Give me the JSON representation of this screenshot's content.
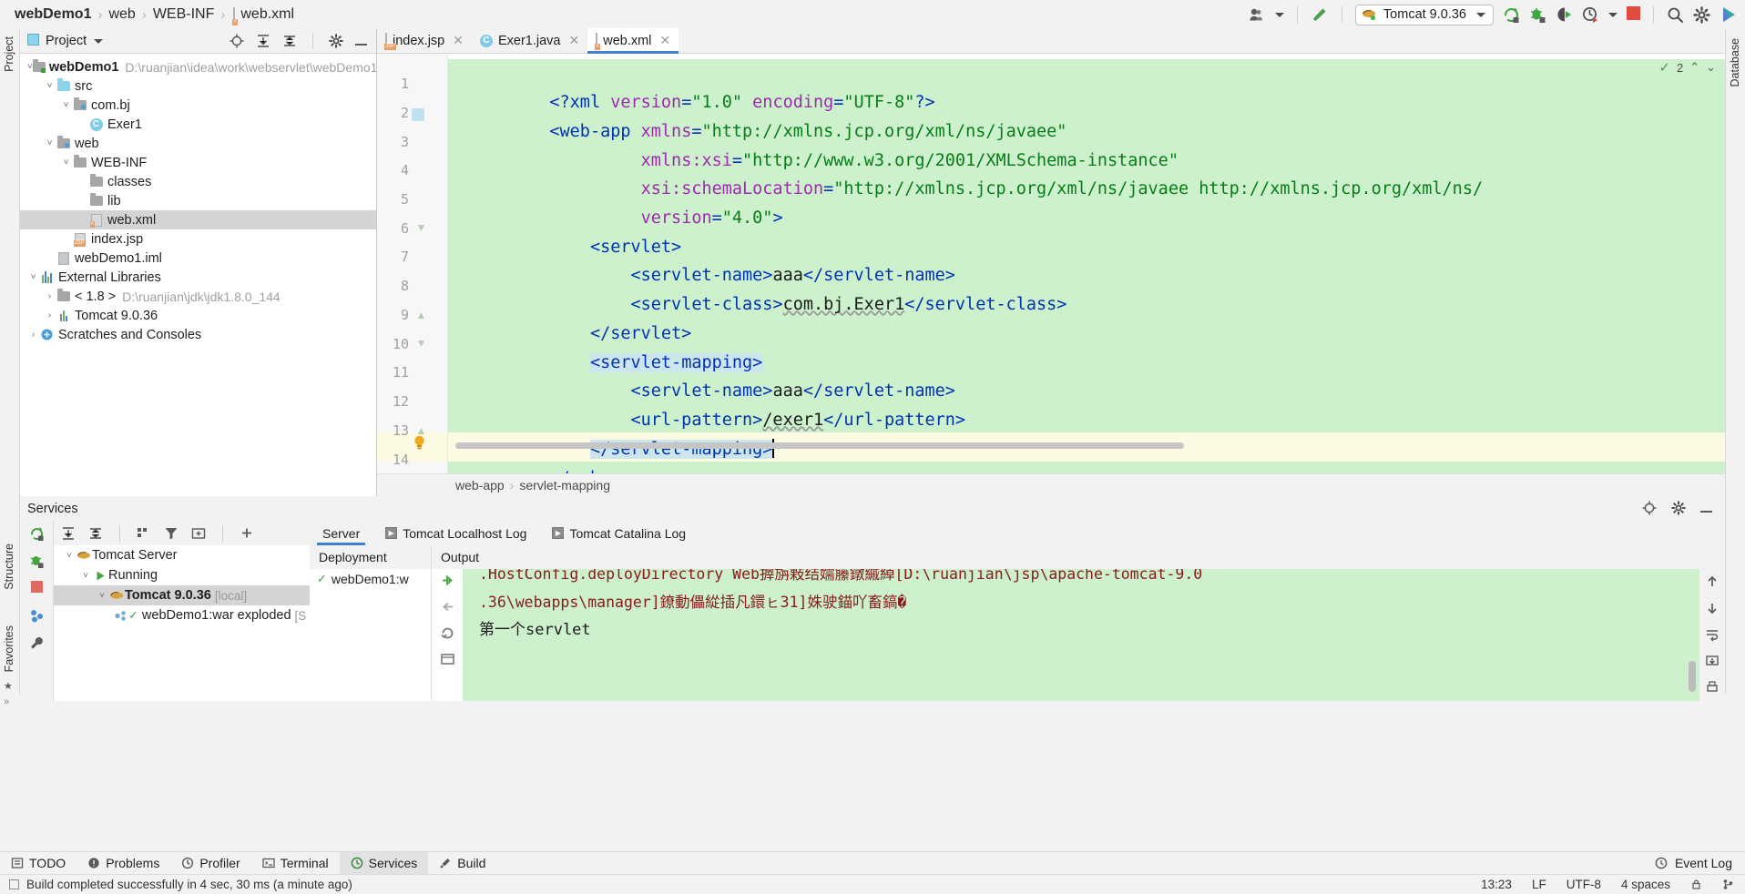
{
  "breadcrumb": {
    "items": [
      "webDemo1",
      "web",
      "WEB-INF",
      "web.xml"
    ],
    "separator": "›"
  },
  "toolbar": {
    "user_icon": "user-icon",
    "build_icon": "hammer-icon",
    "run_config": "Tomcat 9.0.36",
    "run_label": "run-icon",
    "debug_label": "debug-icon",
    "run_coverage_label": "run-with-coverage-icon",
    "profiler_label": "profiler-icon",
    "stop_label": "stop-icon",
    "search_label": "search-icon",
    "settings_label": "settings-icon",
    "updates_label": "updates-icon"
  },
  "rails": {
    "left": [
      "Project",
      "Structure",
      "Favorites"
    ],
    "right": [
      "Database"
    ]
  },
  "project_panel": {
    "title": "Project",
    "tree": [
      {
        "depth": 0,
        "arrow": "v",
        "icon": "module-folder",
        "label": "webDemo1",
        "bold": true,
        "path": "D:\\ruanjian\\idea\\work\\webservlet\\webDemo1",
        "selected": false
      },
      {
        "depth": 1,
        "arrow": "v",
        "icon": "source-folder",
        "label": "src",
        "bold": false,
        "path": "",
        "selected": false
      },
      {
        "depth": 2,
        "arrow": "v",
        "icon": "package-folder",
        "label": "com.bj",
        "bold": false,
        "path": "",
        "selected": false
      },
      {
        "depth": 3,
        "arrow": "",
        "icon": "class",
        "label": "Exer1",
        "bold": false,
        "path": "",
        "selected": false
      },
      {
        "depth": 1,
        "arrow": "v",
        "icon": "web-folder",
        "label": "web",
        "bold": false,
        "path": "",
        "selected": false
      },
      {
        "depth": 2,
        "arrow": "v",
        "icon": "folder",
        "label": "WEB-INF",
        "bold": false,
        "path": "",
        "selected": false
      },
      {
        "depth": 3,
        "arrow": "",
        "icon": "folder",
        "label": "classes",
        "bold": false,
        "path": "",
        "selected": false
      },
      {
        "depth": 3,
        "arrow": "",
        "icon": "folder",
        "label": "lib",
        "bold": false,
        "path": "",
        "selected": false
      },
      {
        "depth": 3,
        "arrow": "",
        "icon": "xml-file",
        "label": "web.xml",
        "bold": false,
        "path": "",
        "selected": true
      },
      {
        "depth": 2,
        "arrow": "",
        "icon": "jsp-file",
        "label": "index.jsp",
        "bold": false,
        "path": "",
        "selected": false
      },
      {
        "depth": 1,
        "arrow": "",
        "icon": "iml-file",
        "label": "webDemo1.iml",
        "bold": false,
        "path": "",
        "selected": false
      },
      {
        "depth": 0,
        "arrow": "v",
        "icon": "libraries",
        "label": "External Libraries",
        "bold": false,
        "path": "",
        "selected": false
      },
      {
        "depth": 1,
        "arrow": ">",
        "icon": "jdk",
        "label": "< 1.8 >",
        "bold": false,
        "path": "D:\\ruanjian\\jdk\\jdk1.8.0_144",
        "selected": false
      },
      {
        "depth": 1,
        "arrow": ">",
        "icon": "library",
        "label": "Tomcat 9.0.36",
        "bold": false,
        "path": "",
        "selected": false
      },
      {
        "depth": 0,
        "arrow": ">",
        "icon": "scratches",
        "label": "Scratches and Consoles",
        "bold": false,
        "path": "",
        "selected": false
      }
    ]
  },
  "editor": {
    "tabs": [
      {
        "label": "index.jsp",
        "icon": "jsp-file",
        "active": false
      },
      {
        "label": "Exer1.java",
        "icon": "class",
        "active": false
      },
      {
        "label": "web.xml",
        "icon": "xml-file",
        "active": true
      }
    ],
    "line_numbers": [
      "1",
      "2",
      "3",
      "4",
      "5",
      "6",
      "7",
      "8",
      "9",
      "10",
      "11",
      "12",
      "13",
      "14"
    ],
    "lines": [
      "<?xml version=\"1.0\" encoding=\"UTF-8\"?>",
      "<web-app xmlns=\"http://xmlns.jcp.org/xml/ns/javaee\"",
      "         xmlns:xsi=\"http://www.w3.org/2001/XMLSchema-instance\"",
      "         xsi:schemaLocation=\"http://xmlns.jcp.org/xml/ns/javaee http://xmlns.jcp.org/xml/ns/",
      "         version=\"4.0\">",
      "    <servlet>",
      "        <servlet-name>aaa</servlet-name>",
      "        <servlet-class>com.bj.Exer1</servlet-class>",
      "    </servlet>",
      "    <servlet-mapping>",
      "        <servlet-name>aaa</servlet-name>",
      "        <url-pattern>/exer1</url-pattern>",
      "    </servlet-mapping>",
      "</web-app>"
    ],
    "inspection_count": "2",
    "breadcrumb": [
      "web-app",
      "servlet-mapping"
    ],
    "breadcrumb_sep": "›"
  },
  "services": {
    "title": "Services",
    "tree": [
      {
        "depth": 0,
        "arrow": "v",
        "icon": "tomcat",
        "label": "Tomcat Server",
        "extra": "",
        "bold": false,
        "selected": false
      },
      {
        "depth": 1,
        "arrow": "v",
        "icon": "run-green",
        "label": "Running",
        "extra": "",
        "bold": false,
        "selected": false
      },
      {
        "depth": 2,
        "arrow": "v",
        "icon": "tomcat",
        "label": "Tomcat 9.0.36",
        "extra": "[local]",
        "bold": true,
        "selected": true
      },
      {
        "depth": 3,
        "arrow": "",
        "icon": "artifact",
        "label": "webDemo1:war exploded",
        "extra": "[S",
        "bold": false,
        "selected": false
      }
    ],
    "tabs": [
      {
        "label": "Server",
        "active": true,
        "icon": ""
      },
      {
        "label": "Tomcat Localhost Log",
        "active": false,
        "icon": "play-box"
      },
      {
        "label": "Tomcat Catalina Log",
        "active": false,
        "icon": "play-box"
      }
    ],
    "deployment_header": "Deployment",
    "deployment_rows": [
      {
        "label": "webDemo1:w",
        "status": "ok"
      }
    ],
    "output_header": "Output",
    "console_lines": [
      {
        "text": ".HostConfig.deployDirectory Web搱旃敤结嬬籘鐓縬綽[D:\\ruanjian\\jsp\\apache-tomcat-9.0",
        "color": "red"
      },
      {
        "text": ".36\\webapps\\manager]鐐動儡緃插凡鐶ㇶ31]姝驶錨吖畜鎬�",
        "color": "red"
      },
      {
        "text": "第一个servlet",
        "color": "black"
      }
    ]
  },
  "bottom_toolbar": {
    "items": [
      {
        "label": "TODO",
        "icon": "todo-icon",
        "active": false
      },
      {
        "label": "Problems",
        "icon": "problems-icon",
        "active": false
      },
      {
        "label": "Profiler",
        "icon": "profiler-icon",
        "active": false
      },
      {
        "label": "Terminal",
        "icon": "terminal-icon",
        "active": false
      },
      {
        "label": "Services",
        "icon": "services-icon",
        "active": true
      },
      {
        "label": "Build",
        "icon": "build-icon",
        "active": false
      }
    ],
    "event_log": "Event Log"
  },
  "status_bar": {
    "message": "Build completed successfully in 4 sec, 30 ms (a minute ago)",
    "time": "13:23",
    "line_sep": "LF",
    "encoding": "UTF-8",
    "indent": "4 spaces"
  }
}
